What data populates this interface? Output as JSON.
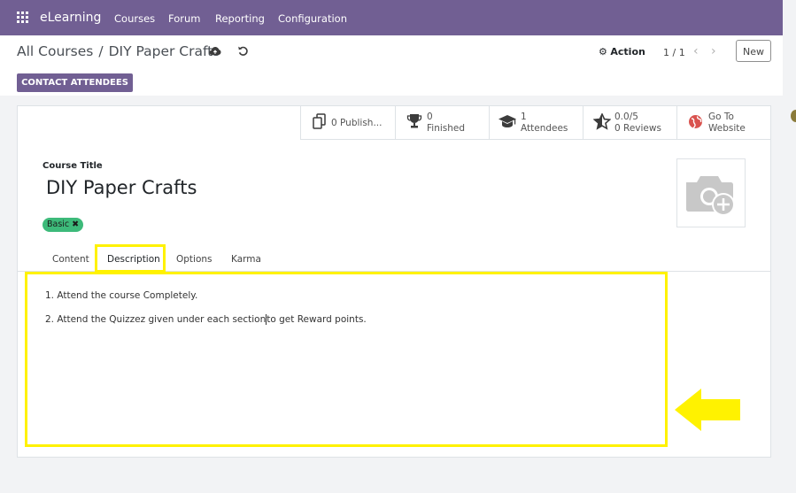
{
  "app": {
    "name": "eLearning",
    "menu": [
      "Courses",
      "Forum",
      "Reporting",
      "Configuration"
    ],
    "accent_color": "#715f93"
  },
  "breadcrumb": {
    "parent": "All Courses",
    "separator": "/",
    "current": "DIY Paper Crafts"
  },
  "toolbar": {
    "action_label": "Action",
    "pager": "1 / 1",
    "new_label": "New",
    "contact_label": "CONTACT ATTENDEES"
  },
  "stats": {
    "published": "0 Publish...",
    "finished_count": "0",
    "finished_label": "Finished",
    "attendees_count": "1",
    "attendees_label": "Attendees",
    "rating": "0.0/5",
    "reviews": "0 Reviews",
    "website_l1": "Go To",
    "website_l2": "Website"
  },
  "form": {
    "title_label": "Course Title",
    "title": "DIY Paper Crafts",
    "tag": "Basic",
    "tag_color": "#3dba7a"
  },
  "tabs": [
    "Content",
    "Description",
    "Options",
    "Karma"
  ],
  "active_tab": "Description",
  "description": {
    "line1": "1. Attend the course Completely.",
    "line2_a": "2. Attend the Quizzez given under each section",
    "line2_b": "to get Reward points."
  },
  "annotation_color": "#fff200"
}
